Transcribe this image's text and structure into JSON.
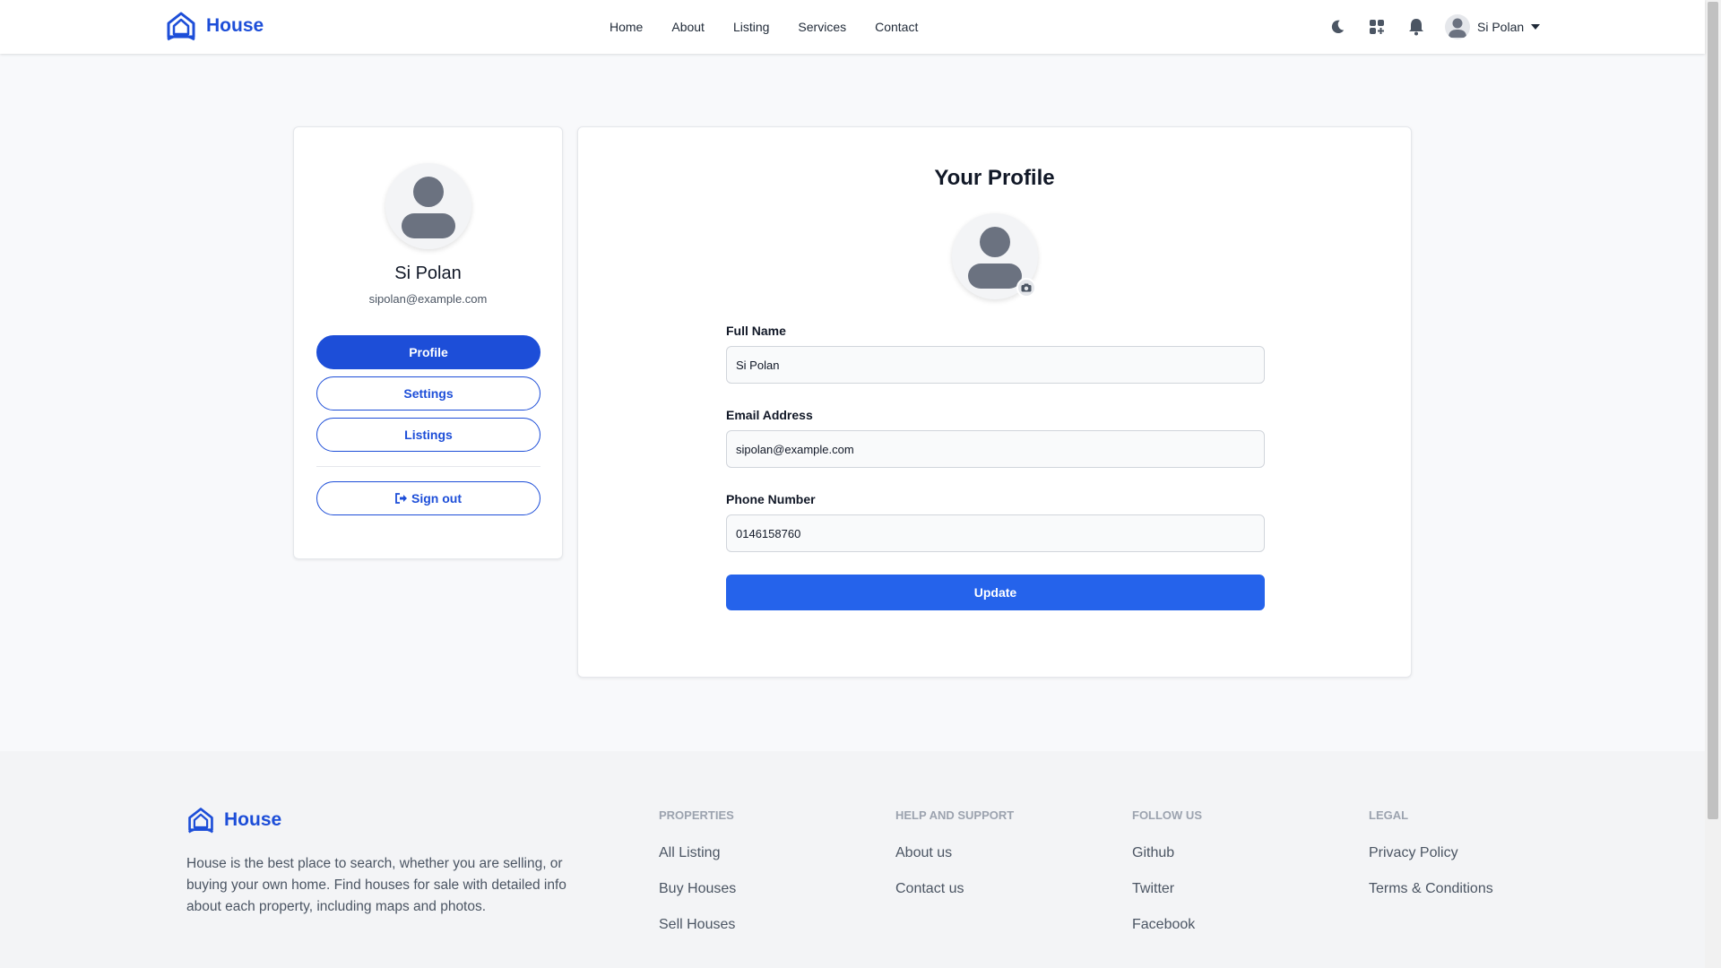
{
  "brand": {
    "name": "House",
    "color": "#1d4ed8"
  },
  "nav": {
    "items": [
      {
        "label": "Home",
        "name": "nav-home"
      },
      {
        "label": "About",
        "name": "nav-about"
      },
      {
        "label": "Listing",
        "name": "nav-listing"
      },
      {
        "label": "Services",
        "name": "nav-services"
      },
      {
        "label": "Contact",
        "name": "nav-contact"
      }
    ]
  },
  "header": {
    "icons": [
      "moon-icon",
      "apps-grid-icon",
      "bell-icon"
    ],
    "user_name": "Si Polan"
  },
  "sidebar": {
    "name": "Si Polan",
    "email": "sipolan@example.com",
    "buttons": {
      "profile": "Profile",
      "settings": "Settings",
      "listings": "Listings",
      "signout": "Sign out"
    }
  },
  "profile_form": {
    "title": "Your Profile",
    "full_name": {
      "label": "Full Name",
      "value": "Si Polan"
    },
    "email": {
      "label": "Email Address",
      "value": "sipolan@example.com"
    },
    "phone": {
      "label": "Phone Number",
      "value": "0146158760"
    },
    "submit_label": "Update"
  },
  "footer": {
    "brand": "House",
    "description": "House is the best place to search, whether you are selling, or buying your own home. Find houses for sale with detailed info about each property, including maps and photos.",
    "columns": [
      {
        "title": "PROPERTIES",
        "links": [
          "All Listing",
          "Buy Houses",
          "Sell Houses"
        ]
      },
      {
        "title": "HELP AND SUPPORT",
        "links": [
          "About us",
          "Contact us"
        ]
      },
      {
        "title": "FOLLOW US",
        "links": [
          "Github",
          "Twitter",
          "Facebook"
        ]
      },
      {
        "title": "LEGAL",
        "links": [
          "Privacy Policy",
          "Terms & Conditions"
        ]
      }
    ]
  },
  "colors": {
    "primary": "#1d4ed8",
    "button": "#2563eb",
    "avatar_fill": "#6b7280",
    "page_bg": "#f8f9fb",
    "footer_bg": "#f3f4f6"
  }
}
